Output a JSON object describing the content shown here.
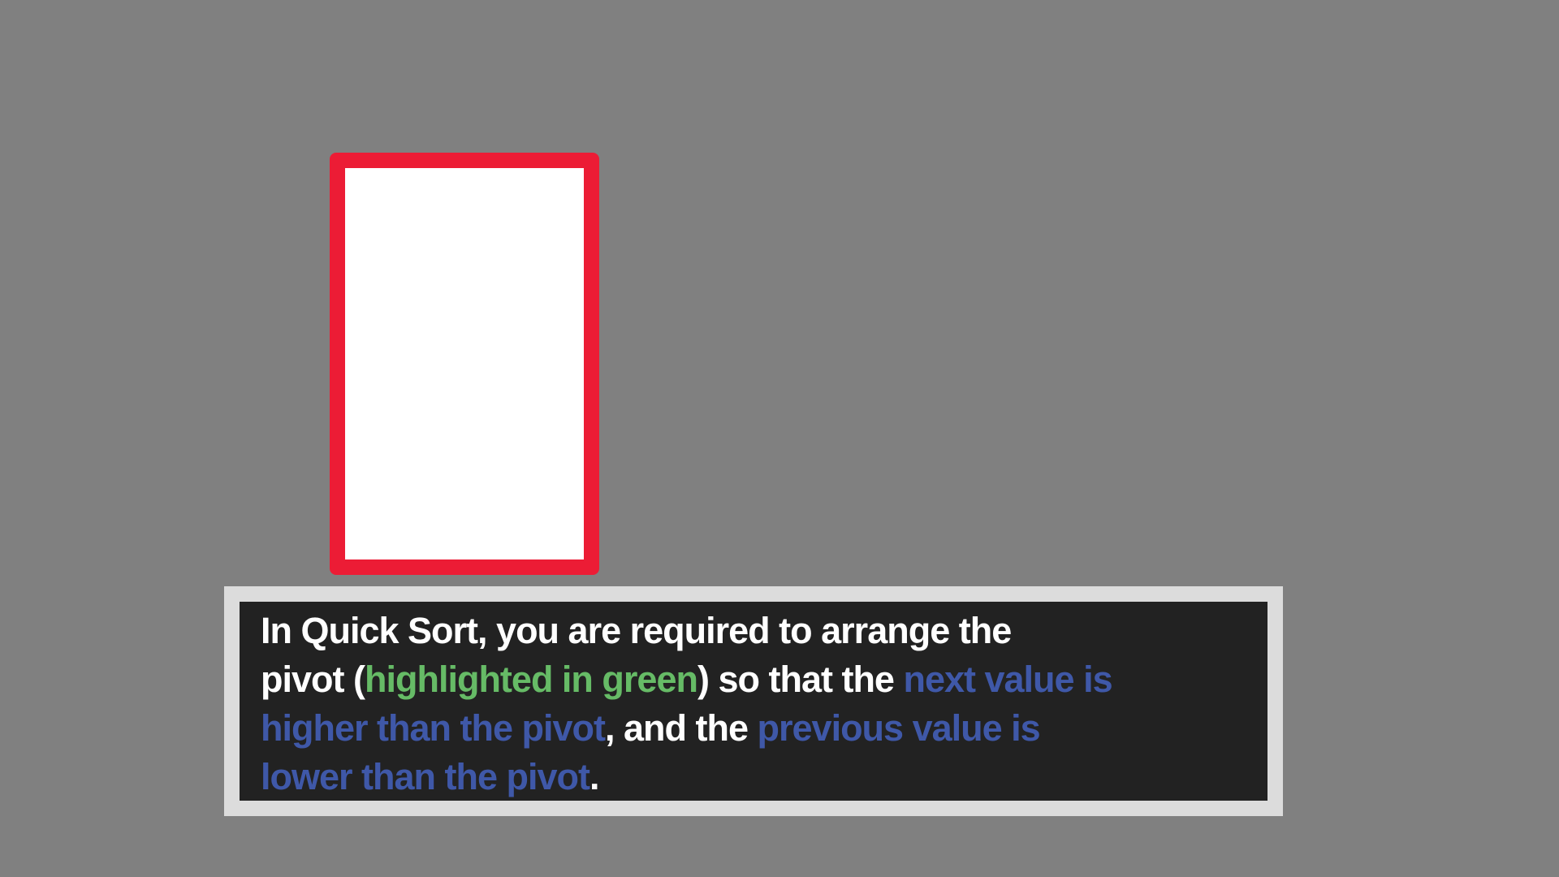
{
  "card": {
    "border_color": "#ec1c35",
    "fill_color": "#ffffff"
  },
  "dialog": {
    "frame_color": "#dcdcdc",
    "background_color": "#222222",
    "line1": "In Quick Sort, you are required to arrange the",
    "line2_before": "pivot (",
    "line2_green": "highlighted in green",
    "line2_after": ") so that the ",
    "line2_blue": "next value is",
    "line3_blue": "higher than the pivot",
    "line3_after": ", and the ",
    "line3_blue2": "previous value is",
    "line4_blue": "lower than the pivot",
    "line4_after": ".",
    "colors": {
      "text": "#ffffff",
      "green_highlight": "#66bb66",
      "blue_highlight": "#3f58a8"
    }
  }
}
